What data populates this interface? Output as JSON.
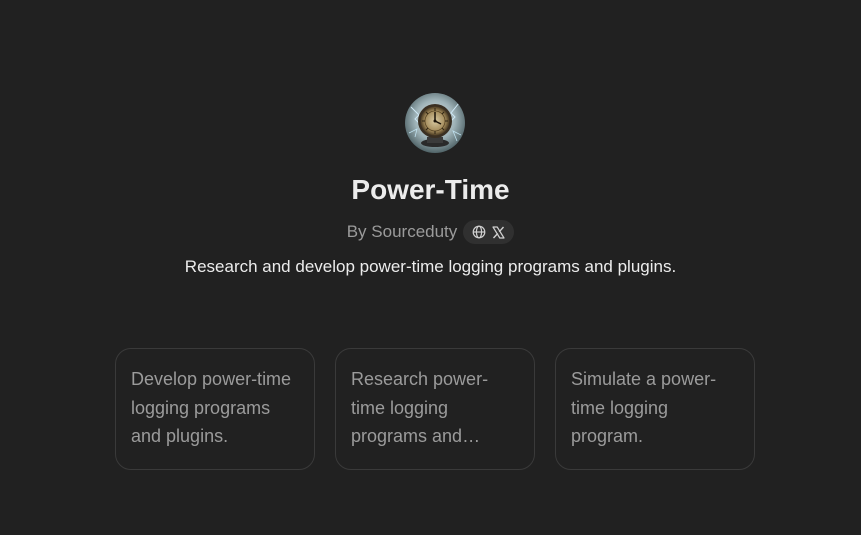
{
  "gpt": {
    "name": "Power-Time",
    "byline": "By Sourceduty",
    "description": "Research and develop power-time logging programs and plugins.",
    "avatar_icon": "clock-avatar-icon",
    "links": [
      {
        "icon": "globe-icon"
      },
      {
        "icon": "x-logo-icon"
      }
    ]
  },
  "starters": [
    {
      "label": "Develop power-time logging programs and plugins."
    },
    {
      "label": "Research power-time logging programs and plugins."
    },
    {
      "label": "Simulate a power-time logging program."
    }
  ],
  "colors": {
    "background": "#212121",
    "text_primary": "#ececec",
    "text_secondary": "#9b9b9b",
    "card_border": "#3a3a3a",
    "pill_background": "#303030"
  }
}
